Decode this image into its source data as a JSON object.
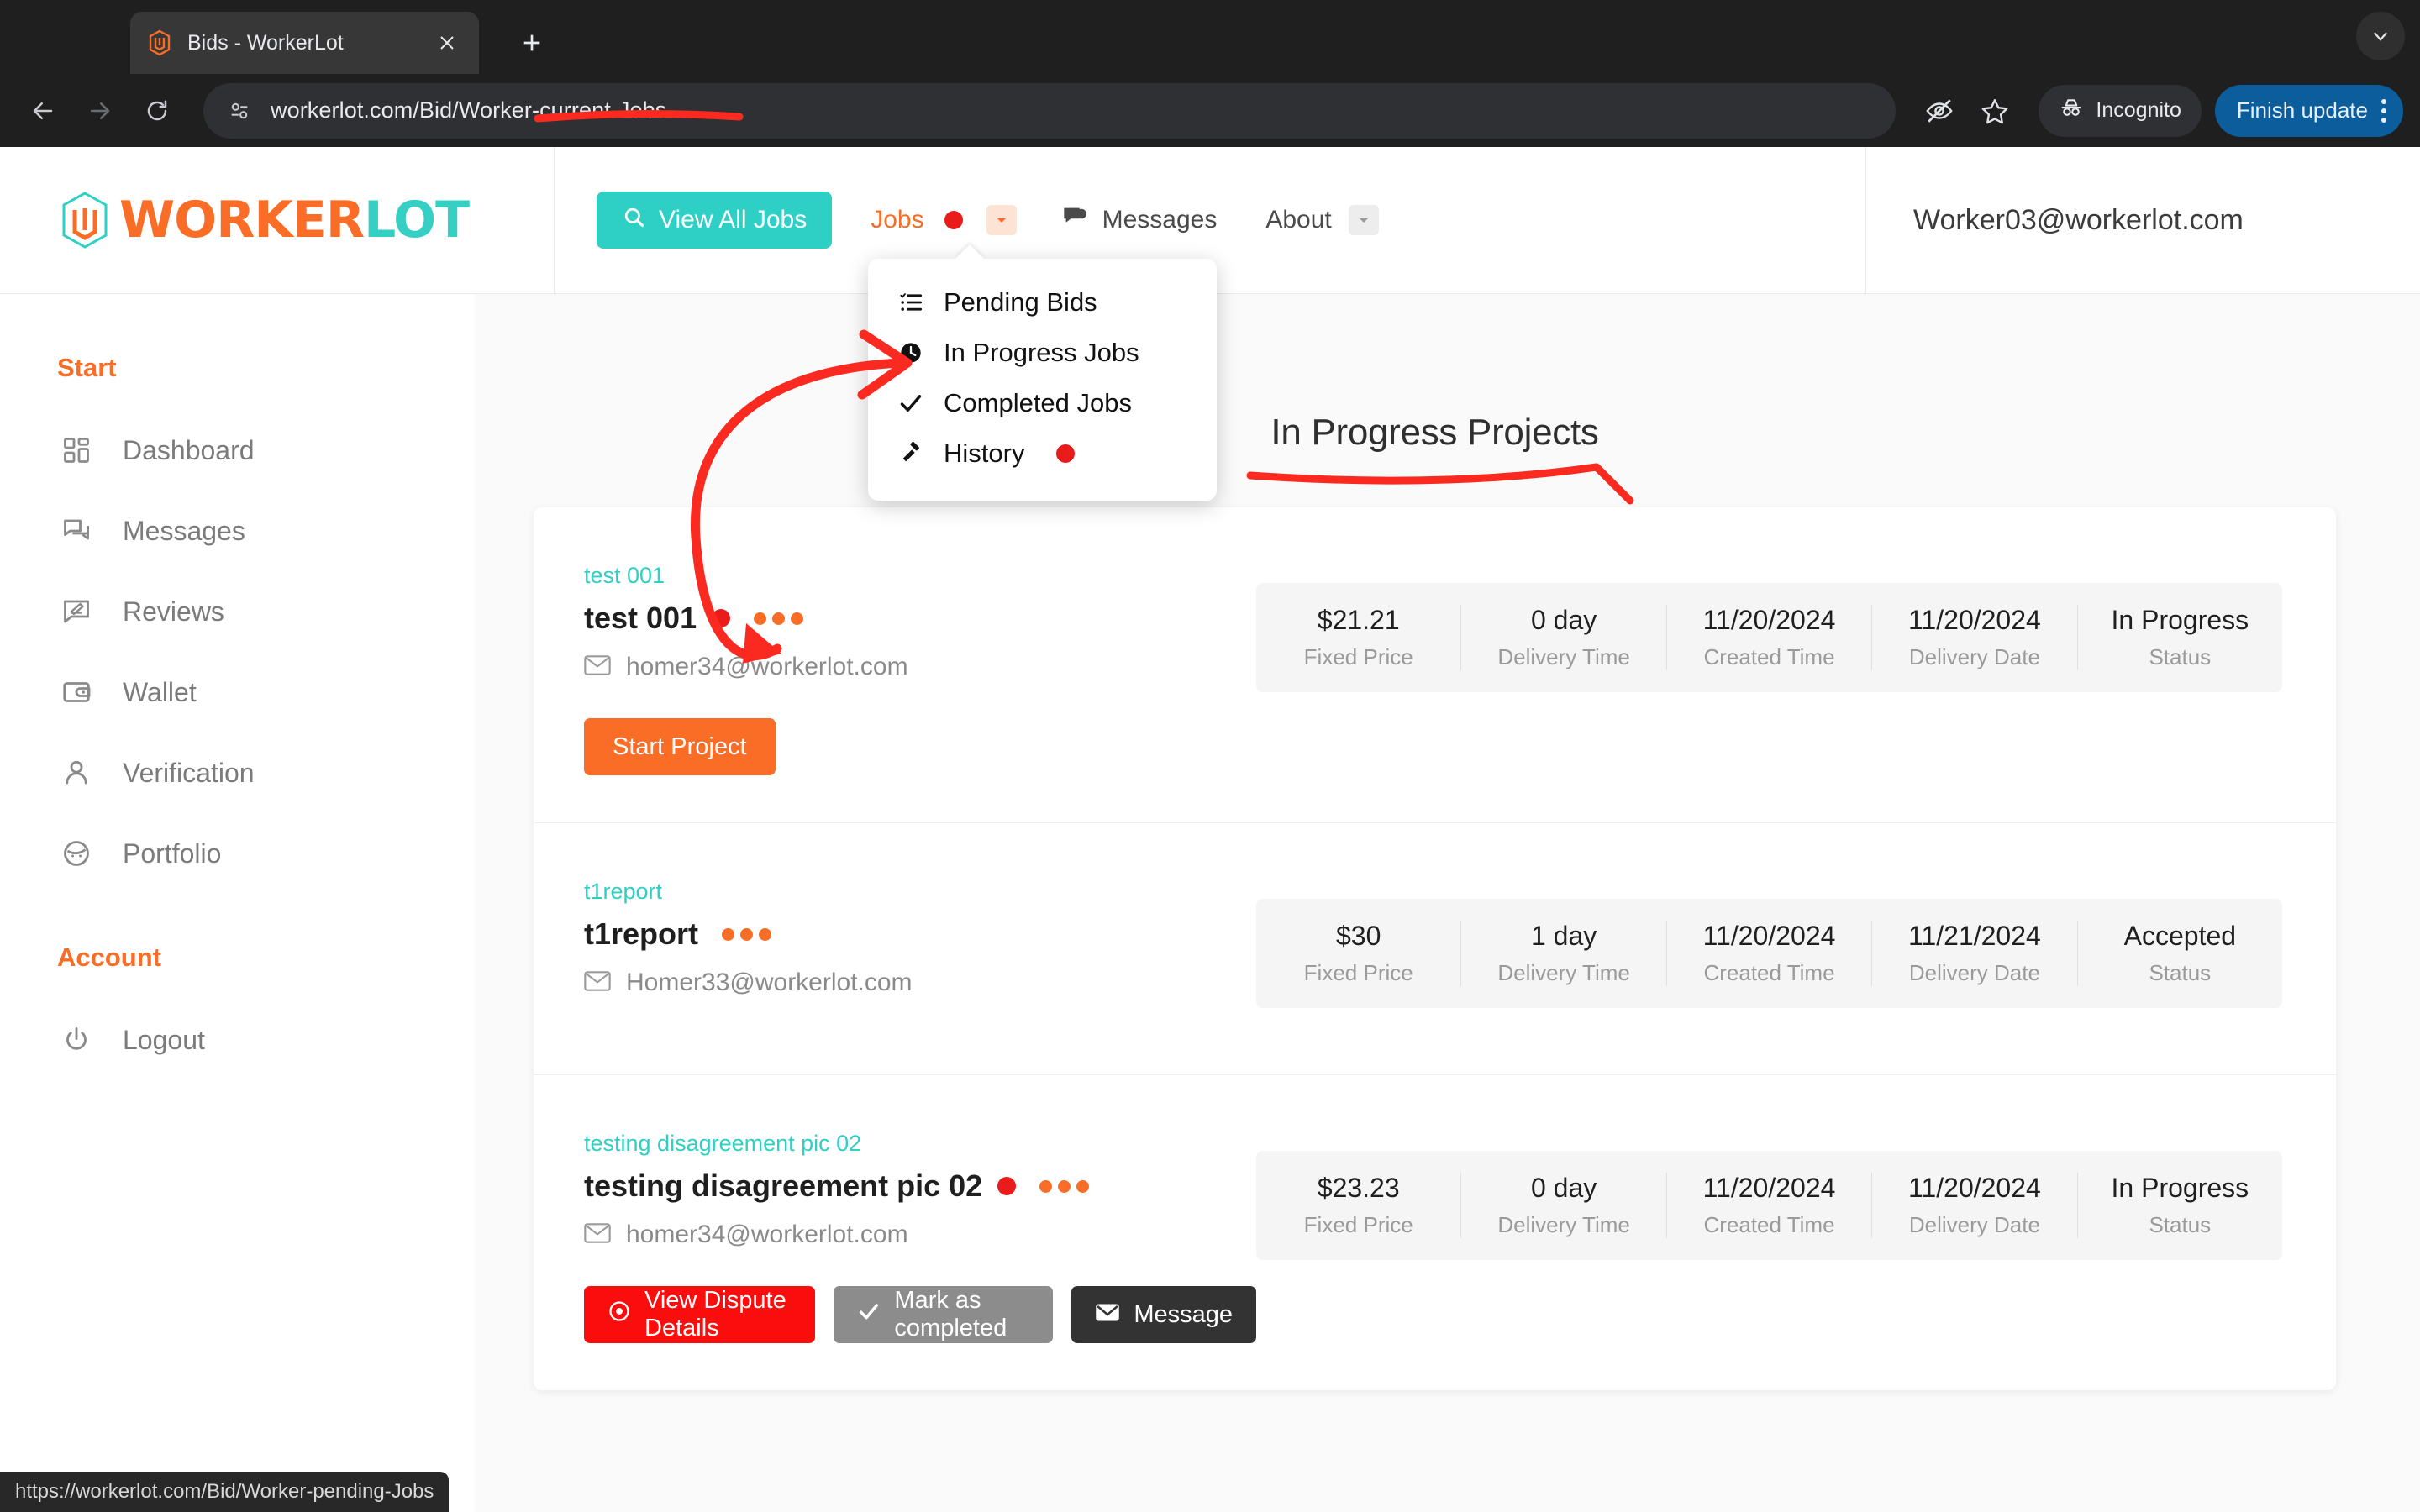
{
  "browser": {
    "tab": {
      "title": "Bids - WorkerLot",
      "favicon_icon": "workerlot-logo-icon",
      "close_icon": "close-icon"
    },
    "new_tab_label": "+",
    "back_icon": "back-arrow-icon",
    "forward_icon": "forward-arrow-icon",
    "reload_icon": "reload-icon",
    "omnibox": {
      "site_info_icon": "site-info-icon",
      "url": "workerlot.com/Bid/Worker-current-Jobs"
    },
    "toolbar_icons": [
      "eye-off-icon",
      "star-icon"
    ],
    "incognito_label": "Incognito",
    "finish_update_label": "Finish update",
    "menu_icon": "kebab-menu-icon",
    "collapse_icon": "chevron-down-icon"
  },
  "header": {
    "logo": {
      "worker": "WORKER",
      "lot": "LOT"
    },
    "view_all_jobs": "View All Jobs",
    "nav": {
      "jobs": "Jobs",
      "messages": "Messages",
      "about": "About"
    },
    "user_email": "Worker03@workerlot.com"
  },
  "dropdown": {
    "items": [
      {
        "label": "Pending Bids",
        "icon": "list-check-icon",
        "badge": false
      },
      {
        "label": "In Progress Jobs",
        "icon": "clock-icon",
        "badge": false
      },
      {
        "label": "Completed Jobs",
        "icon": "check-icon",
        "badge": false
      },
      {
        "label": "History",
        "icon": "gavel-icon",
        "badge": true
      }
    ]
  },
  "sidebar": {
    "start_heading": "Start",
    "start_items": [
      {
        "label": "Dashboard",
        "icon": "dashboard-icon"
      },
      {
        "label": "Messages",
        "icon": "chat-icon"
      },
      {
        "label": "Reviews",
        "icon": "review-icon"
      },
      {
        "label": "Wallet",
        "icon": "wallet-icon"
      },
      {
        "label": "Verification",
        "icon": "user-icon"
      },
      {
        "label": "Portfolio",
        "icon": "portfolio-face-icon"
      }
    ],
    "account_heading": "Account",
    "account_items": [
      {
        "label": "Logout",
        "icon": "power-icon"
      }
    ]
  },
  "main": {
    "title": "In Progress Projects",
    "stat_labels": [
      "Fixed Price",
      "Delivery Time",
      "Created Time",
      "Delivery Date",
      "Status"
    ],
    "cards": [
      {
        "sub": "test 001",
        "title": "test 001",
        "has_red_dot": true,
        "email": "homer34@workerlot.com",
        "stats": [
          "$21.21",
          "0 day",
          "11/20/2024",
          "11/20/2024",
          "In Progress"
        ],
        "actions": [
          {
            "label": "Start Project",
            "style": "start",
            "icon": ""
          }
        ]
      },
      {
        "sub": "t1report",
        "title": "t1report",
        "has_red_dot": false,
        "email": "Homer33@workerlot.com",
        "stats": [
          "$30",
          "1 day",
          "11/20/2024",
          "11/21/2024",
          "Accepted"
        ],
        "actions": []
      },
      {
        "sub": "testing disagreement pic 02",
        "title": "testing disagreement pic 02",
        "has_red_dot": true,
        "email": "homer34@workerlot.com",
        "stats": [
          "$23.23",
          "0 day",
          "11/20/2024",
          "11/20/2024",
          "In Progress"
        ],
        "actions": [
          {
            "label": "View Dispute Details",
            "style": "dispute",
            "icon": "eye-target-icon"
          },
          {
            "label": "Mark as completed",
            "style": "complete",
            "icon": "check-icon"
          },
          {
            "label": "Message",
            "style": "message",
            "icon": "envelope-icon"
          }
        ]
      }
    ]
  },
  "status_bar": {
    "url": "https://workerlot.com/Bid/Worker-pending-Jobs"
  },
  "colors": {
    "brand_orange": "#f96d26",
    "brand_teal": "#2ed0c5",
    "badge_red": "#ea1b1b",
    "annotation_red": "#fb2a20",
    "chrome_dark": "#1f1f1f",
    "update_blue": "#0b5d9c"
  }
}
